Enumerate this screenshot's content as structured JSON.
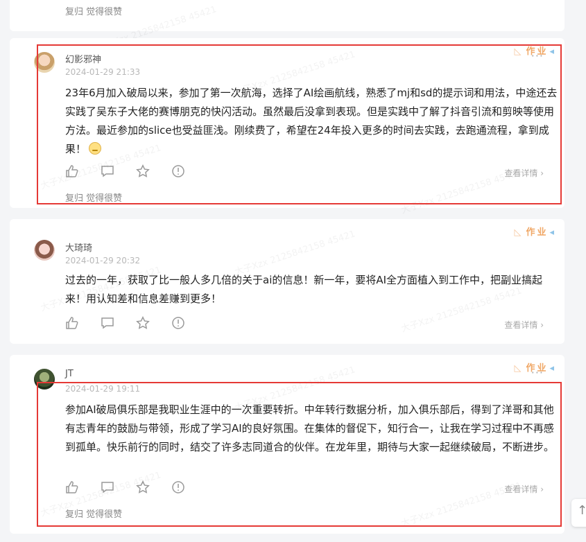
{
  "top_card": {
    "footer": "复归 觉得很赞"
  },
  "watermark": "大子Xzx 2125842158 45421",
  "badge": {
    "text": "作业"
  },
  "more_label": "···",
  "details_label": "查看详情",
  "scroll_top_icon": "↑",
  "comments": [
    {
      "author": "幻影邪神",
      "time": "2024-01-29 21:33",
      "content": "23年6月加入破局以来，参加了第一次航海，选择了AI绘画航线，熟悉了mj和sd的提示词和用法，中途还去实践了吴东子大佬的赛博朋克的快闪活动。虽然最后没拿到表现。但是实践中了解了抖音引流和剪映等使用方法。最近参加的slice也受益匪浅。刚续费了，希望在24年投入更多的时间去实践，去跑通流程，拿到成果！",
      "footer": "复归 觉得很赞"
    },
    {
      "author": "大琦琦",
      "time": "2024-01-29 20:32",
      "content": "过去的一年，获取了比一般人多几倍的关于ai的信息！新一年，要将AI全方面植入到工作中，把副业搞起来！用认知差和信息差赚到更多！"
    },
    {
      "author": "JT",
      "time": "2024-01-29 19:11",
      "content": "参加AI破局俱乐部是我职业生涯中的一次重要转折。中年转行数据分析，加入俱乐部后，得到了洋哥和其他有志青年的鼓励与带领，形成了学习AI的良好氛围。在集体的督促下，知行合一，让我在学习过程中不再感到孤单。快乐前行的同时，结交了许多志同道合的伙伴。在龙年里，期待与大家一起继续破局，不断进步。",
      "footer": "复归 觉得很赞"
    }
  ]
}
